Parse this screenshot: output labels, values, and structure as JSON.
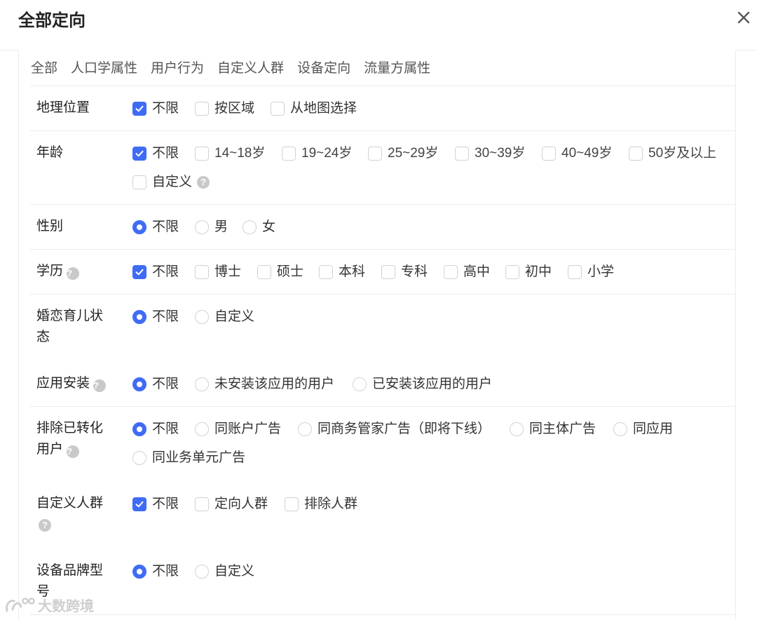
{
  "header": {
    "title": "全部定向"
  },
  "tabs": [
    "全部",
    "人口学属性",
    "用户行为",
    "自定义人群",
    "设备定向",
    "流量方属性"
  ],
  "rows": {
    "geo": {
      "label": "地理位置",
      "options": [
        "不限",
        "按区域",
        "从地图选择"
      ]
    },
    "age": {
      "label": "年龄",
      "options": [
        "不限",
        "14~18岁",
        "19~24岁",
        "25~29岁",
        "30~39岁",
        "40~49岁",
        "50岁及以上",
        "自定义"
      ]
    },
    "gender": {
      "label": "性别",
      "options": [
        "不限",
        "男",
        "女"
      ]
    },
    "education": {
      "label": "学历",
      "options": [
        "不限",
        "博士",
        "硕士",
        "本科",
        "专科",
        "高中",
        "初中",
        "小学"
      ]
    },
    "marital": {
      "label_line1": "婚恋育儿状",
      "label_line2": "态",
      "options": [
        "不限",
        "自定义"
      ]
    },
    "app_install": {
      "label": "应用安装",
      "options": [
        "不限",
        "未安装该应用的用户",
        "已安装该应用的用户"
      ]
    },
    "exclude_converted": {
      "label_line1": "排除已转化",
      "label_line2": "用户",
      "options": [
        "不限",
        "同账户广告",
        "同商务管家广告（即将下线）",
        "同主体广告",
        "同应用",
        "同业务单元广告"
      ]
    },
    "custom_audience": {
      "label": "自定义人群",
      "options": [
        "不限",
        "定向人群",
        "排除人群"
      ]
    },
    "device_brand": {
      "label_line1": "设备品牌型",
      "label_line2": "号",
      "options": [
        "不限",
        "自定义"
      ]
    }
  },
  "watermark": {
    "text": "大数跨境"
  },
  "colors": {
    "accent": "#3f6cf5",
    "border": "#d2d2d2",
    "divider": "#ececec",
    "help_icon": "#c9c9c9"
  },
  "icons": {
    "close": "close-icon",
    "help": "question-circle-icon",
    "check": "checkmark-icon"
  }
}
